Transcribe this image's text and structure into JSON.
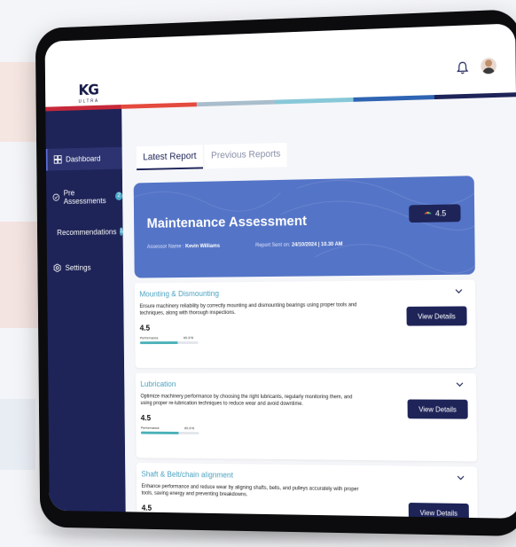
{
  "header": {
    "logo_main": "KG",
    "logo_sub": "ULTRA"
  },
  "colors": {
    "navy": "#1e2458",
    "hero_blue": "#5474c7",
    "teal": "#4ab0b8",
    "title_teal": "#4aa2c0",
    "colorbar": [
      "#c7283a",
      "#e44a3d",
      "#a9bdcc",
      "#87c8d8",
      "#2f64b3",
      "#1e2458"
    ]
  },
  "sidebar": {
    "items": [
      {
        "label": "Dashboard",
        "icon": "dashboard-icon",
        "active": true,
        "badge": ""
      },
      {
        "label": "Pre Assessments",
        "icon": "checklist-icon",
        "active": false,
        "badge": "2"
      },
      {
        "label": "Recommendations",
        "icon": "document-icon",
        "active": false,
        "badge": "1"
      },
      {
        "label": "Settings",
        "icon": "settings-icon",
        "active": false,
        "badge": ""
      }
    ]
  },
  "tabs": [
    {
      "label": "Latest Report",
      "active": true
    },
    {
      "label": "Previous Reports",
      "active": false
    }
  ],
  "report": {
    "title": "Maintenance Assessment",
    "assessor_label": "Assessor Name :",
    "assessor_name": "Kevin Williams",
    "sent_label": "Report Sent on:",
    "sent_value": "24/10/2024 | 10.30 AM",
    "score": "4.5"
  },
  "cards": [
    {
      "title": "Mounting & Dismounting",
      "description": "Ensure machinery reliability by correctly mounting and dismounting bearings using proper tools and techniques, along with thorough inspections.",
      "score": "4.5",
      "performance_label": "Performance",
      "performance_value": "65.376",
      "performance_fraction": 0.654,
      "button": "View Details"
    },
    {
      "title": "Lubrication",
      "description": "Optimize machinery performance by choosing the right lubricants, regularly monitoring them, and using proper re-lubrication techniques to reduce wear and avoid downtime.",
      "score": "4.5",
      "performance_label": "Performance",
      "performance_value": "65.376",
      "performance_fraction": 0.654,
      "button": "View Details"
    },
    {
      "title": "Shaft & Belt/chain alignment",
      "description": "Enhance performance and reduce wear by aligning shafts, belts, and pulleys accurately with proper tools, saving energy and preventing breakdowns.",
      "score": "4.5",
      "button": "View Details"
    }
  ]
}
